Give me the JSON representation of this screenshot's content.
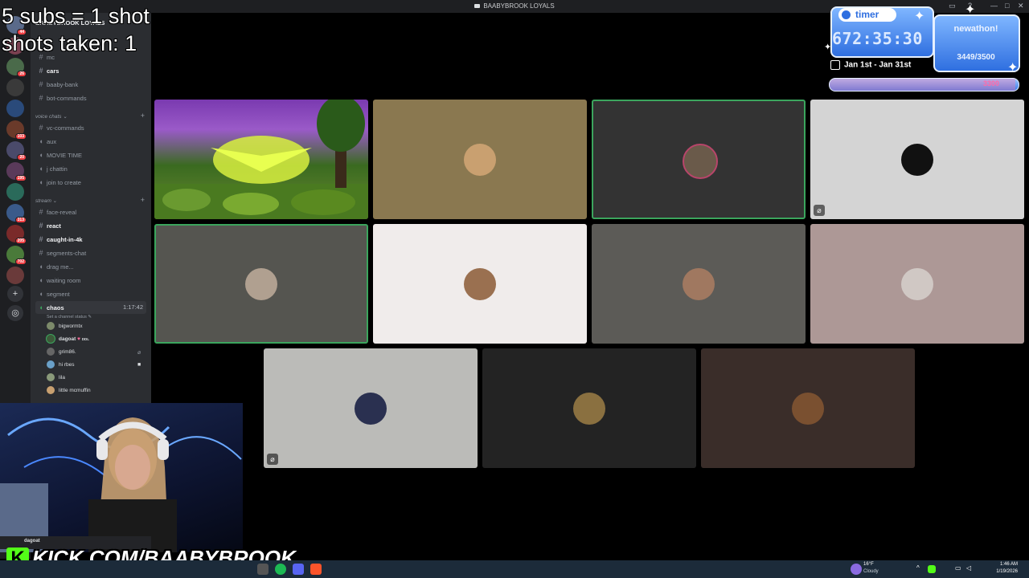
{
  "window": {
    "title": "BAABYBROOK LOYALS"
  },
  "overlay": {
    "subs_rule": "5 subs = 1 shot",
    "shots_taken": "shots taken: 1"
  },
  "timer_widget": {
    "label": "timer",
    "value": "672:35:30",
    "date_range": "Jan 1st - Jan 31st",
    "newathon_title": "newathon!",
    "newathon_count": "3449/3500",
    "goal_value": "3300",
    "goal_fraction": 0.985
  },
  "sidebar": {
    "server_name": "BAABYBROOK LOYALS",
    "channels": [
      {
        "label": "mc",
        "icon": "hash-icon",
        "bold": false
      },
      {
        "label": "cars",
        "icon": "hash-icon",
        "bold": true
      },
      {
        "label": "baaby-bank",
        "icon": "hash-icon",
        "bold": false
      },
      {
        "label": "bot-commands",
        "icon": "hash-icon",
        "bold": false
      }
    ],
    "voice_category": "voice chats",
    "voice_channels": [
      {
        "label": "vc-commands",
        "icon": "hash-icon"
      },
      {
        "label": "aux",
        "icon": "speaker-icon"
      },
      {
        "label": "MOVIE TIME",
        "icon": "speaker-icon"
      },
      {
        "label": "j chattin",
        "icon": "speaker-icon"
      },
      {
        "label": "join to create",
        "icon": "speaker-icon"
      }
    ],
    "stream_category": "stream",
    "stream_channels": [
      {
        "label": "face-reveal",
        "icon": "hash-icon",
        "bold": false
      },
      {
        "label": "react",
        "icon": "hash-icon",
        "bold": true
      },
      {
        "label": "caught-in-4k",
        "icon": "hash-icon",
        "bold": true
      },
      {
        "label": "segments-chat",
        "icon": "hash-icon",
        "bold": false
      },
      {
        "label": "drag me...",
        "icon": "speaker-icon",
        "bold": false
      },
      {
        "label": "waiting room",
        "icon": "speaker-icon",
        "bold": false
      },
      {
        "label": "segment",
        "icon": "speaker-icon",
        "bold": false
      }
    ],
    "active_voice": {
      "name": "chaos",
      "duration": "1:17:42",
      "status_placeholder": "Set a channel status"
    },
    "voice_users": [
      {
        "name": "bigwormtx",
        "color": "#7c8a6a"
      },
      {
        "name": "dagoat",
        "color": "#3d5a3a",
        "tag": "DDL"
      },
      {
        "name": "grim86.",
        "color": "#666"
      },
      {
        "name": "hi rbes",
        "color": "#6aa0c8"
      },
      {
        "name": "lila",
        "color": "#8a9a7a"
      },
      {
        "name": "little mcmuffin",
        "color": "#c8a070"
      }
    ],
    "server_badges": [
      "44",
      "26",
      "103",
      "20",
      "195",
      "313",
      "205",
      "702"
    ]
  },
  "grid": {
    "tiles": [
      {
        "name": "tile-1",
        "bg": "#4a6a2a",
        "speaking": false,
        "stream": true
      },
      {
        "name": "tile-2",
        "bg": "#8a7850",
        "speaking": false,
        "pfp": "#c9a070"
      },
      {
        "name": "tile-3",
        "bg": "#333333",
        "speaking": true,
        "pfp": "#b8456a"
      },
      {
        "name": "tile-4",
        "bg": "#d4d4d4",
        "speaking": false,
        "pfp": "#111111",
        "muted": true
      },
      {
        "name": "tile-5",
        "bg": "#555550",
        "speaking": true,
        "pfp": "#b0a090"
      },
      {
        "name": "tile-6",
        "bg": "#f0eceb",
        "speaking": false,
        "pfp": "#9a7050"
      },
      {
        "name": "tile-7",
        "bg": "#5c5b57",
        "speaking": false,
        "pfp": "#a07860"
      },
      {
        "name": "tile-8",
        "bg": "#ad9896",
        "speaking": false,
        "pfp": "#d0c8c4"
      },
      {
        "name": "tile-9",
        "bg": "#bbbbb8",
        "speaking": false,
        "pfp": "#c03030",
        "muted": true
      },
      {
        "name": "tile-10",
        "bg": "#232323",
        "speaking": false,
        "pfp": "#8a7040"
      },
      {
        "name": "tile-11",
        "bg": "#3a2d29",
        "speaking": false,
        "pfp": "#7a5030"
      }
    ]
  },
  "bottom": {
    "user_name": "dagoat",
    "kick_letter": "K",
    "kick_url": "KICK.COM/BAABYBROOK"
  },
  "taskbar": {
    "weather_temp": "16°F",
    "weather_desc": "Cloudy",
    "time": "1:46 AM",
    "date": "1/19/2026"
  }
}
